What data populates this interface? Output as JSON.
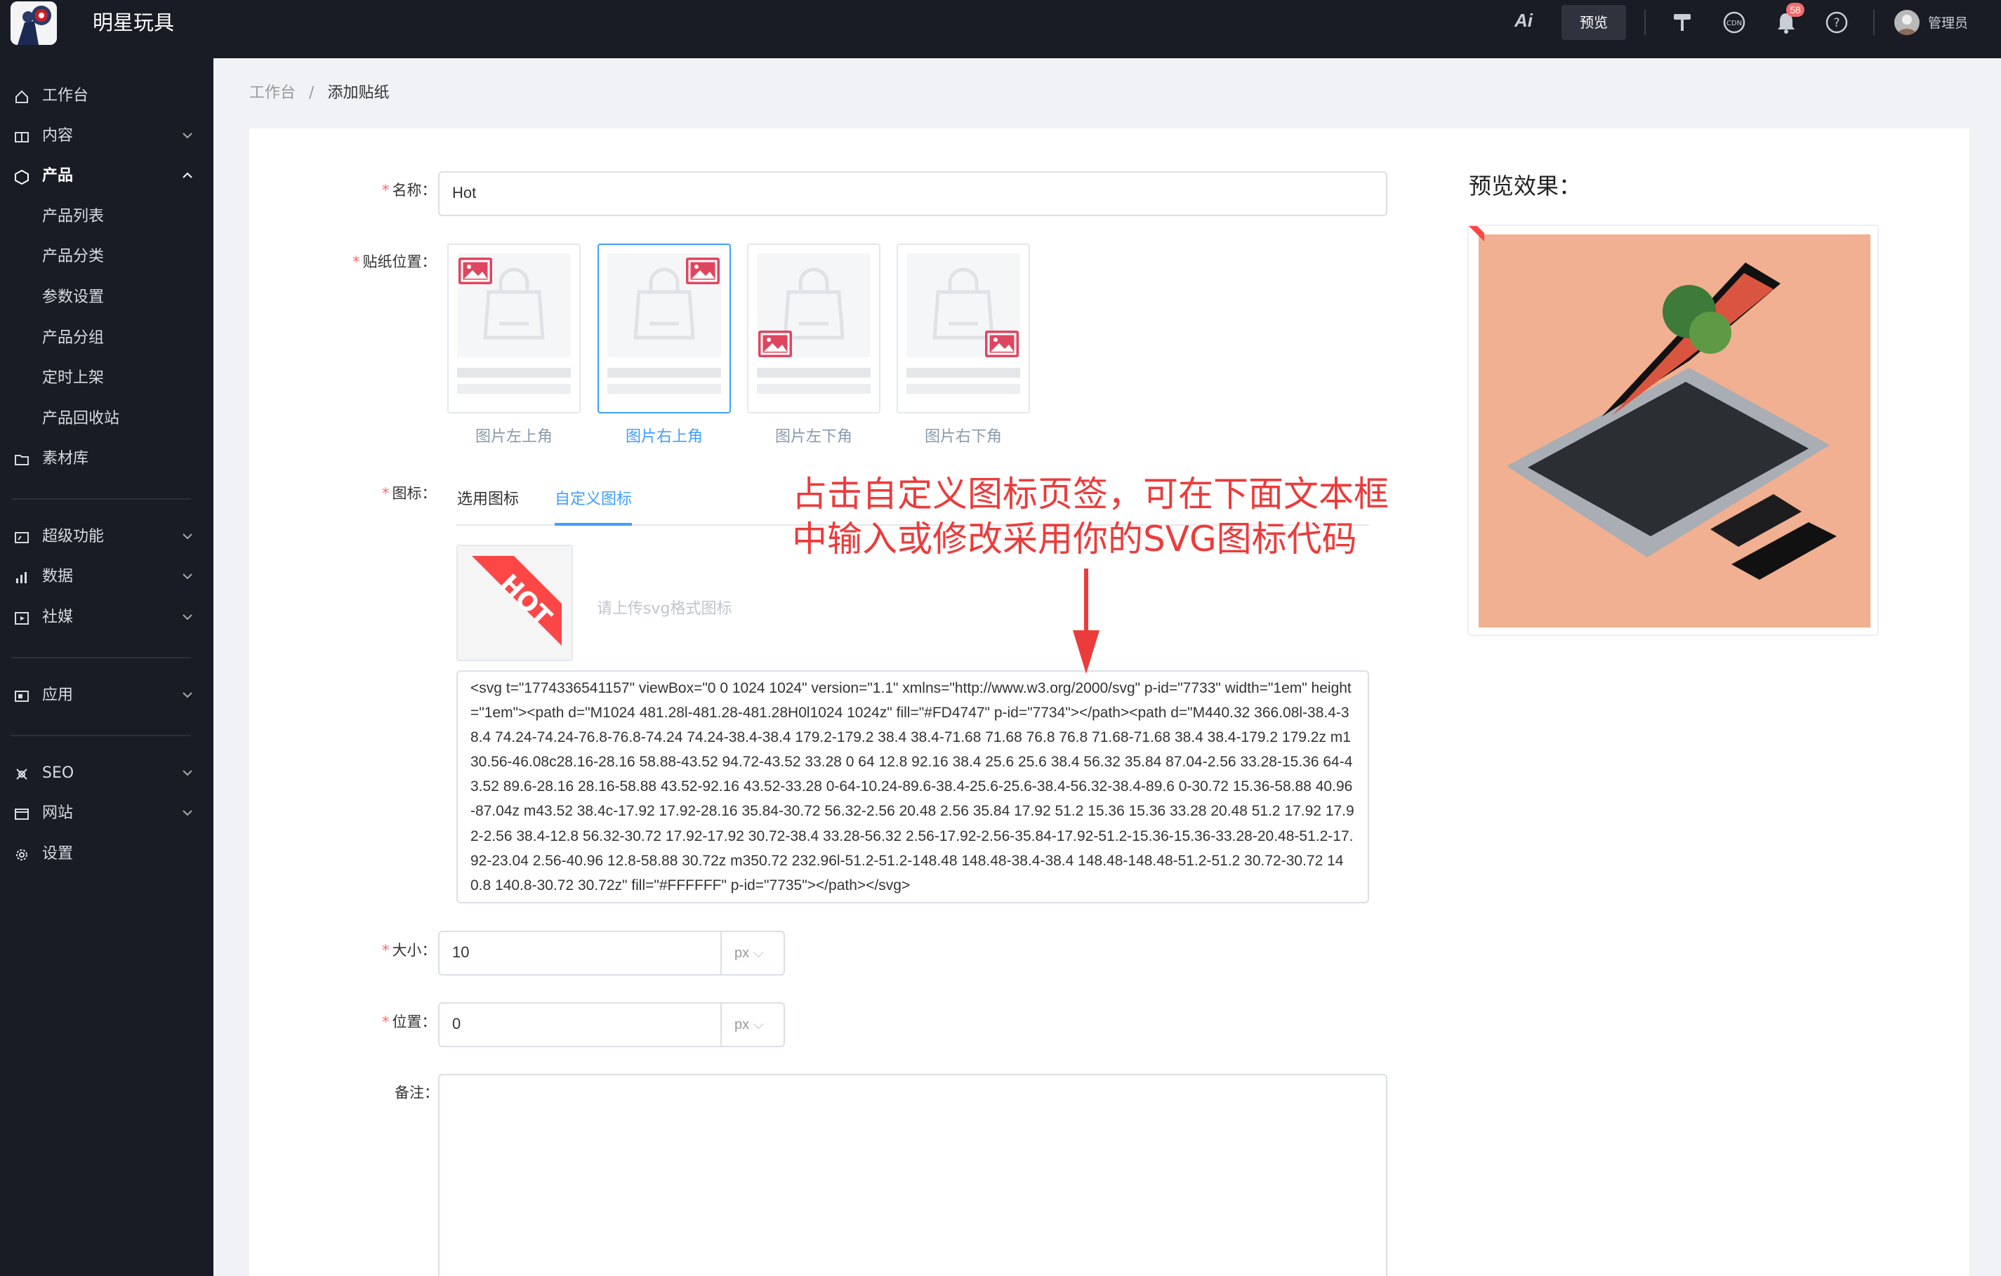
{
  "app": {
    "brand": "明星玩具",
    "ai_label": "Ai",
    "preview_label": "预览",
    "notification_count": "58",
    "user": "管理员"
  },
  "sidebar": {
    "items": [
      {
        "label": "工作台",
        "icon": "home-icon"
      },
      {
        "label": "内容",
        "icon": "book-icon"
      },
      {
        "label": "产品",
        "icon": "cube-icon"
      },
      {
        "label": "产品列表"
      },
      {
        "label": "产品分类"
      },
      {
        "label": "参数设置"
      },
      {
        "label": "产品分组"
      },
      {
        "label": "定时上架"
      },
      {
        "label": "产品回收站"
      },
      {
        "label": "素材库",
        "icon": "folder-icon"
      },
      {
        "label": "超级功能",
        "icon": "dashboard-icon"
      },
      {
        "label": "数据",
        "icon": "chart-icon"
      },
      {
        "label": "社媒",
        "icon": "media-icon"
      },
      {
        "label": "应用",
        "icon": "app-icon"
      },
      {
        "label": "SEO",
        "icon": "seo-icon"
      },
      {
        "label": "网站",
        "icon": "site-icon"
      },
      {
        "label": "设置",
        "icon": "gear-icon"
      }
    ]
  },
  "breadcrumb": {
    "root": "工作台",
    "sep": "/",
    "current": "添加贴纸"
  },
  "form": {
    "name": {
      "label": "名称",
      "value": "Hot"
    },
    "position": {
      "label": "贴纸位置",
      "options": [
        "图片左上角",
        "图片右上角",
        "图片左下角",
        "图片右下角"
      ],
      "selected": "图片右上角"
    },
    "icon": {
      "label": "图标",
      "tabs": [
        "选用图标",
        "自定义图标"
      ],
      "active_tab": "自定义图标",
      "upload_hint": "请上传svg格式图标",
      "svg_code": "<svg t=\"1774336541157\" viewBox=\"0 0 1024 1024\" version=\"1.1\" xmlns=\"http://www.w3.org/2000/svg\" p-id=\"7733\" width=\"1em\" height=\"1em\"><path d=\"M1024 481.28l-481.28-481.28H0l1024 1024z\" fill=\"#FD4747\" p-id=\"7734\"></path><path d=\"M440.32 366.08l-38.4-38.4 74.24-74.24-76.8-76.8-74.24 74.24-38.4-38.4 179.2-179.2 38.4 38.4-71.68 71.68 76.8 76.8 71.68-71.68 38.4 38.4-179.2 179.2z m130.56-46.08c28.16-28.16 58.88-43.52 94.72-43.52 33.28 0 64 12.8 92.16 38.4 25.6 25.6 38.4 56.32 35.84 87.04-2.56 33.28-15.36 64-43.52 89.6-28.16 28.16-58.88 43.52-92.16 43.52-33.28 0-64-10.24-89.6-38.4-25.6-25.6-38.4-56.32-38.4-89.6 0-30.72 15.36-58.88 40.96-87.04z m43.52 38.4c-17.92 17.92-28.16 35.84-30.72 56.32-2.56 20.48 2.56 35.84 17.92 51.2 15.36 15.36 33.28 20.48 51.2 17.92 17.92-2.56 38.4-12.8 56.32-30.72 17.92-17.92 30.72-38.4 33.28-56.32 2.56-17.92-2.56-35.84-17.92-51.2-15.36-15.36-33.28-20.48-51.2-17.92-23.04 2.56-40.96 12.8-58.88 30.72z m350.72 232.96l-51.2-51.2-148.48 148.48-38.4-38.4 148.48-148.48-51.2-51.2 30.72-30.72 140.8 140.8-30.72 30.72z\" fill=\"#FFFFFF\" p-id=\"7735\"></path></svg>",
      "sticker_text": "HOT",
      "sticker_color": "#FD4747"
    },
    "size": {
      "label": "大小",
      "value": "10",
      "unit": "px"
    },
    "offset": {
      "label": "位置",
      "value": "0",
      "unit": "px"
    },
    "remark": {
      "label": "备注",
      "value": ""
    }
  },
  "annotation": {
    "line1": "占击自定义图标页签，可在下面文本框",
    "line2": "中输入或修改采用你的SVG图标代码",
    "color": "#ec3b3b"
  },
  "preview": {
    "title": "预览效果：",
    "bg_color": "#f0b091"
  }
}
